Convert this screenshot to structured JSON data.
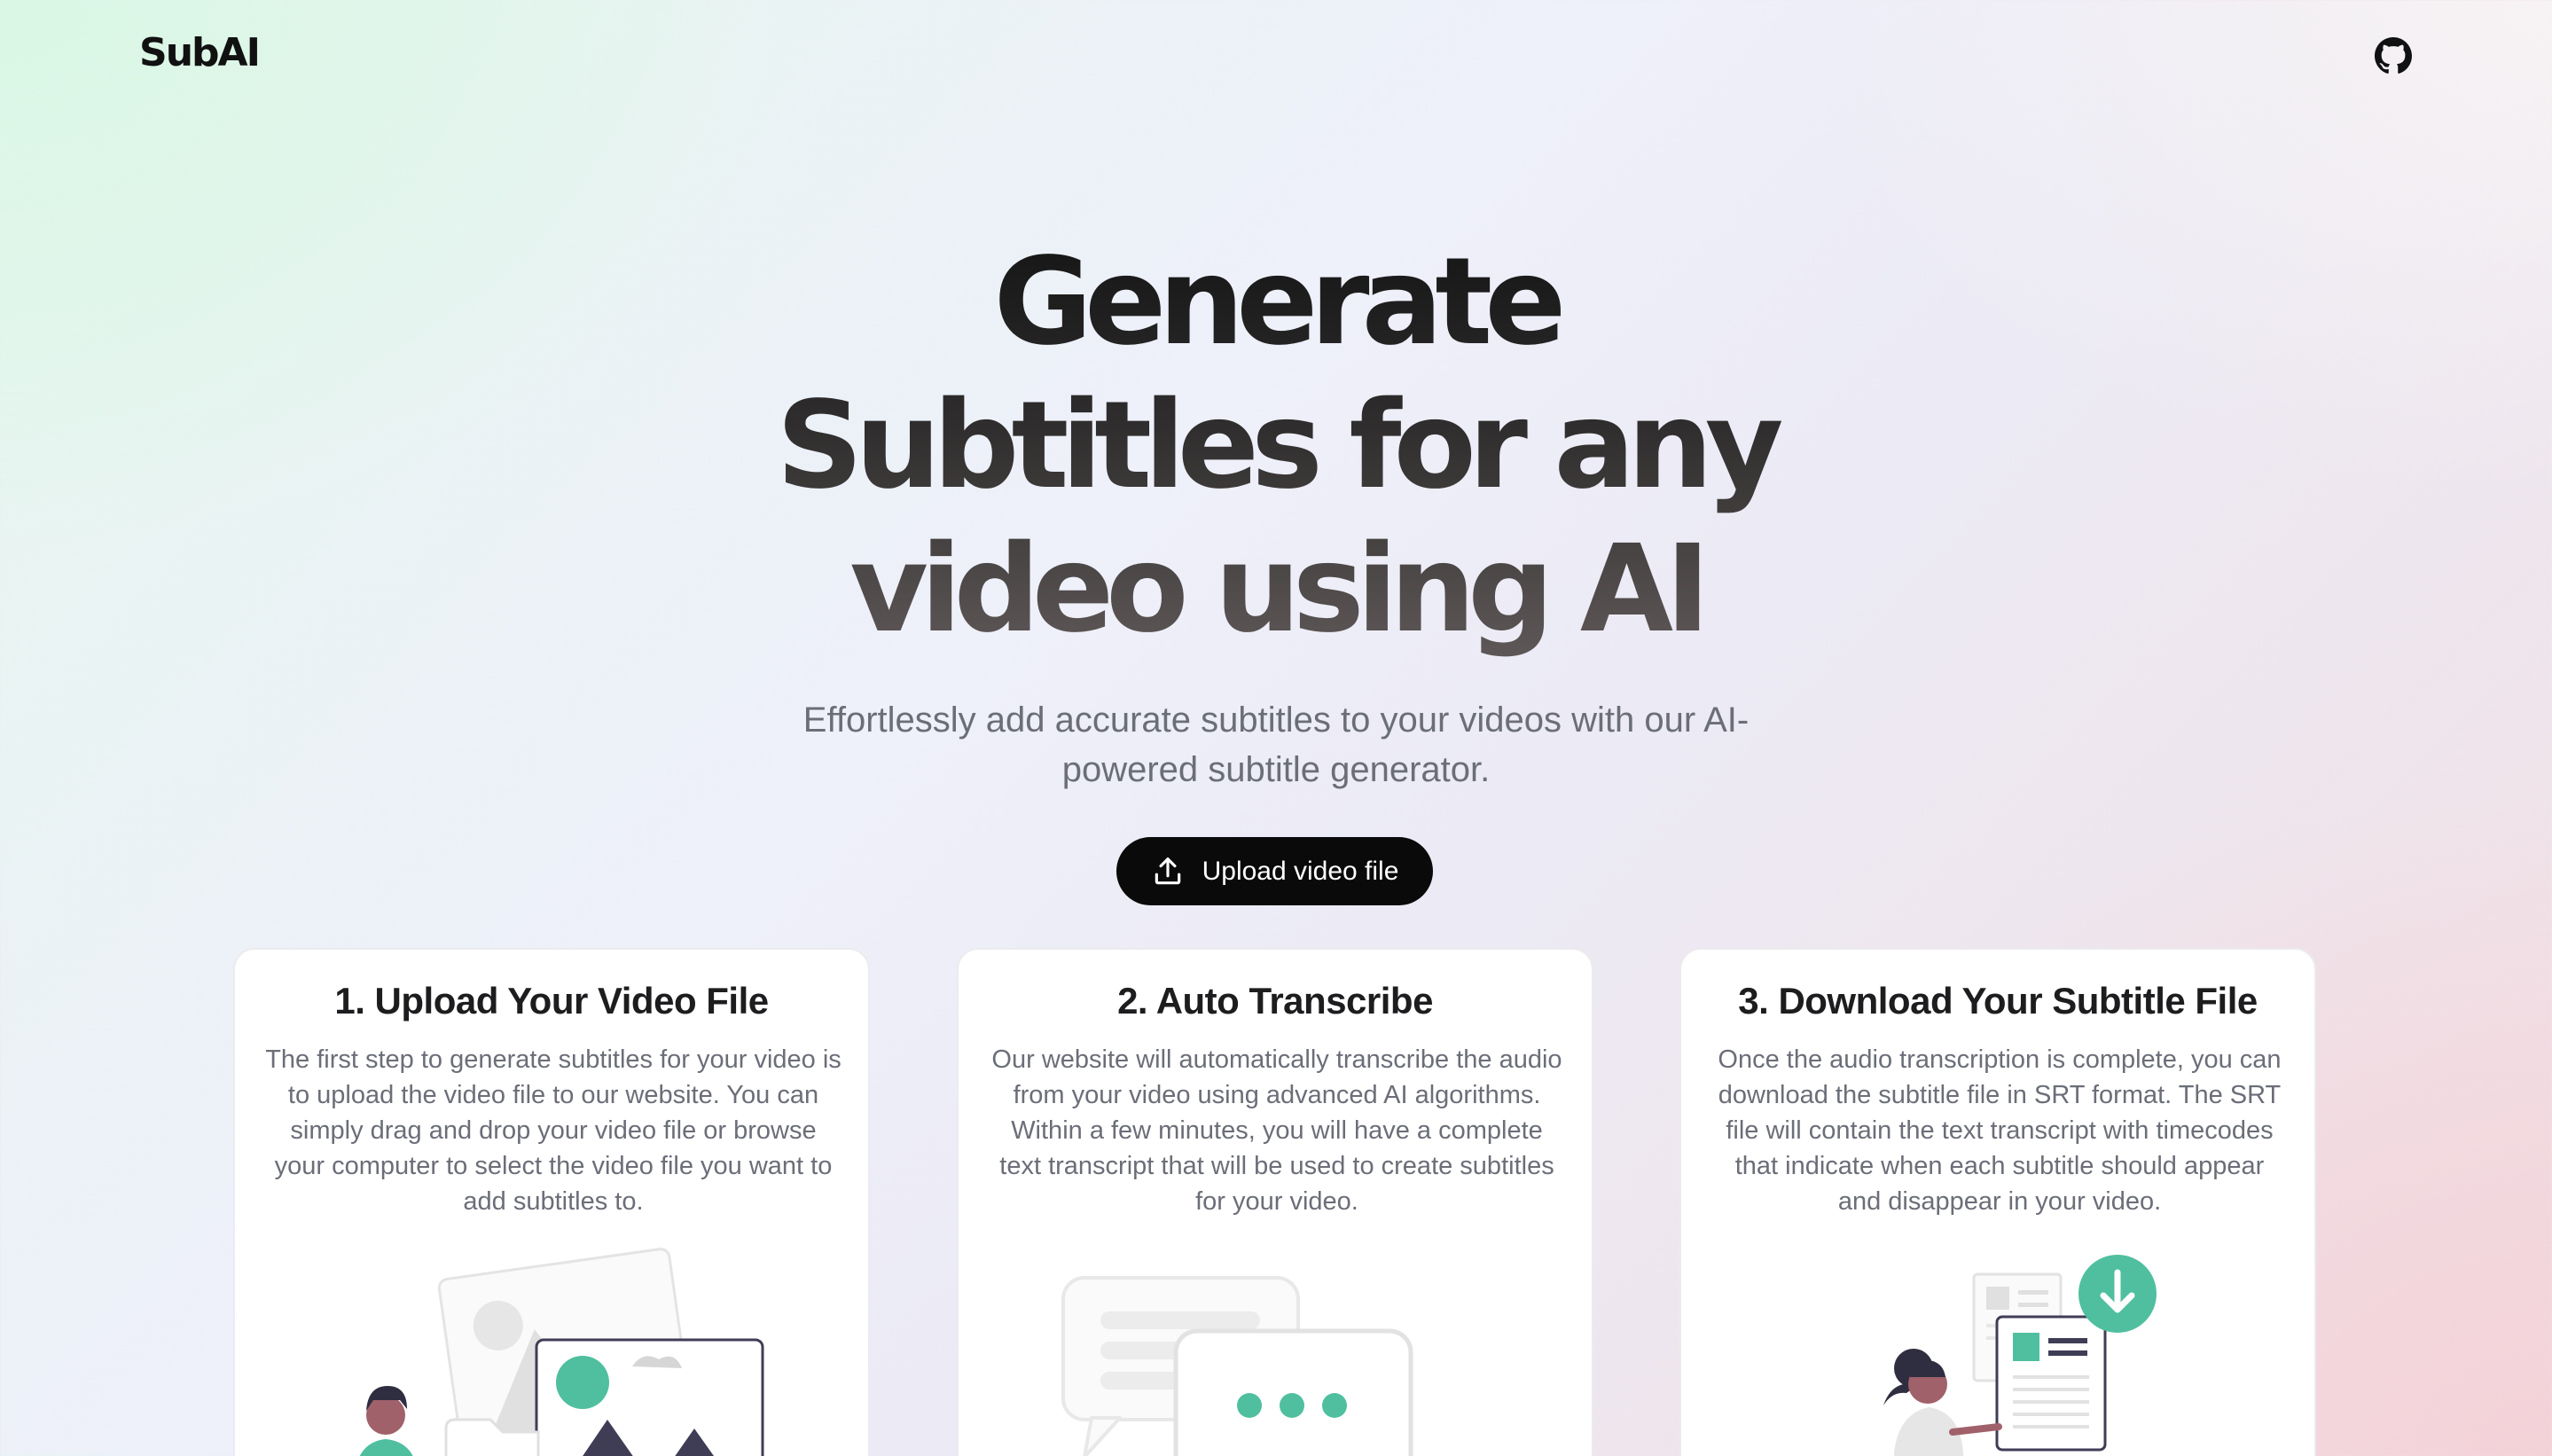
{
  "header": {
    "logo": "SubAI",
    "github_icon": "github-icon"
  },
  "hero": {
    "title_lines": [
      "Generate",
      "Subtitles for any",
      "video using AI"
    ],
    "subtitle": "Effortlessly add accurate subtitles to your videos with our AI-powered subtitle generator.",
    "upload_button": {
      "label": "Upload video file",
      "icon": "upload-icon"
    }
  },
  "steps": [
    {
      "title": "1. Upload Your Video File",
      "description": "The first step to generate subtitles for your video is to upload the video file to our website. You can simply drag and drop your video file or browse your computer to select the video file you want to add subtitles to.",
      "illustration": "upload-illustration"
    },
    {
      "title": "2. Auto Transcribe",
      "description": "Our website will automatically transcribe the audio from your video using advanced AI algorithms. Within a few minutes, you will have a complete text transcript that will be used to create subtitles for your video.",
      "illustration": "chat-bubbles-illustration"
    },
    {
      "title": "3. Download Your Subtitle File",
      "description": "Once the audio transcription is complete, you can download the subtitle file in SRT format. The SRT file will contain the text transcript with timecodes that indicate when each subtitle should appear and disappear in your video.",
      "illustration": "download-illustration"
    }
  ],
  "colors": {
    "accent": "#4fbf9f",
    "button_bg": "#0a0a0a",
    "muted_text": "#6b6e78",
    "dark_illustration": "#3f3d56"
  }
}
